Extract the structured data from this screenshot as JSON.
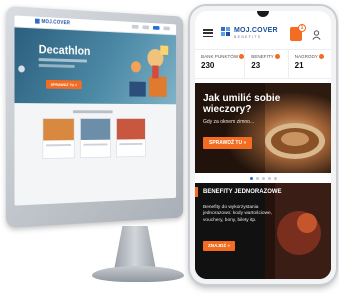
{
  "desktop": {
    "logo": "MOJ.COVER",
    "hero_title": "Decathlon",
    "hero_button": "SPRAWDŹ TU »",
    "colors": {
      "hero": "#3f7a99",
      "accent": "#f36c21",
      "brand": "#1f4e9c"
    }
  },
  "app": {
    "brand_name": "MOJ.COVER",
    "brand_tagline": "BENEFITS",
    "wallet_badge": "1",
    "stats": [
      {
        "label": "BANK PUNKTÓW",
        "value": "230"
      },
      {
        "label": "BENEFITY",
        "value": "23"
      },
      {
        "label": "NAGRODY",
        "value": "21"
      }
    ],
    "promo": {
      "title": "Jak umilić sobie wieczory?",
      "subtitle": "Gdy za oknem zimno...",
      "button": "SPRAWDŹ TU »"
    },
    "carousel": {
      "count": 5,
      "active": 0
    },
    "card": {
      "title": "BENEFITY JEDNORAZOWE",
      "text": "Benefity do wykorzystania jednorazowo: kody wartościowe, vouchery, bony, bilety itp.",
      "button": "ZNAJDŹ »"
    },
    "colors": {
      "accent": "#f36c21",
      "brand": "#1f4e9c",
      "dot_active": "#1f6fd6"
    }
  }
}
